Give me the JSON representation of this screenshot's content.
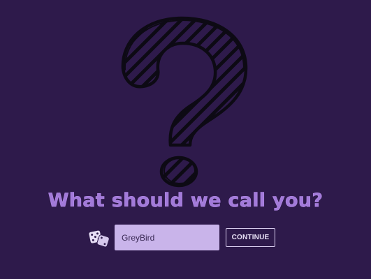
{
  "prompt": {
    "heading": "What should we call you?"
  },
  "name_form": {
    "input_value": "GreyBird",
    "continue_label": "CONTINUE",
    "randomize_icon": "dice-icon"
  },
  "illustration": {
    "icon": "question-mark-icon"
  },
  "colors": {
    "background": "#2e1a4b",
    "heading": "#a27ad9",
    "input_background": "#c9b4ea",
    "button_border": "#d9cdee"
  }
}
